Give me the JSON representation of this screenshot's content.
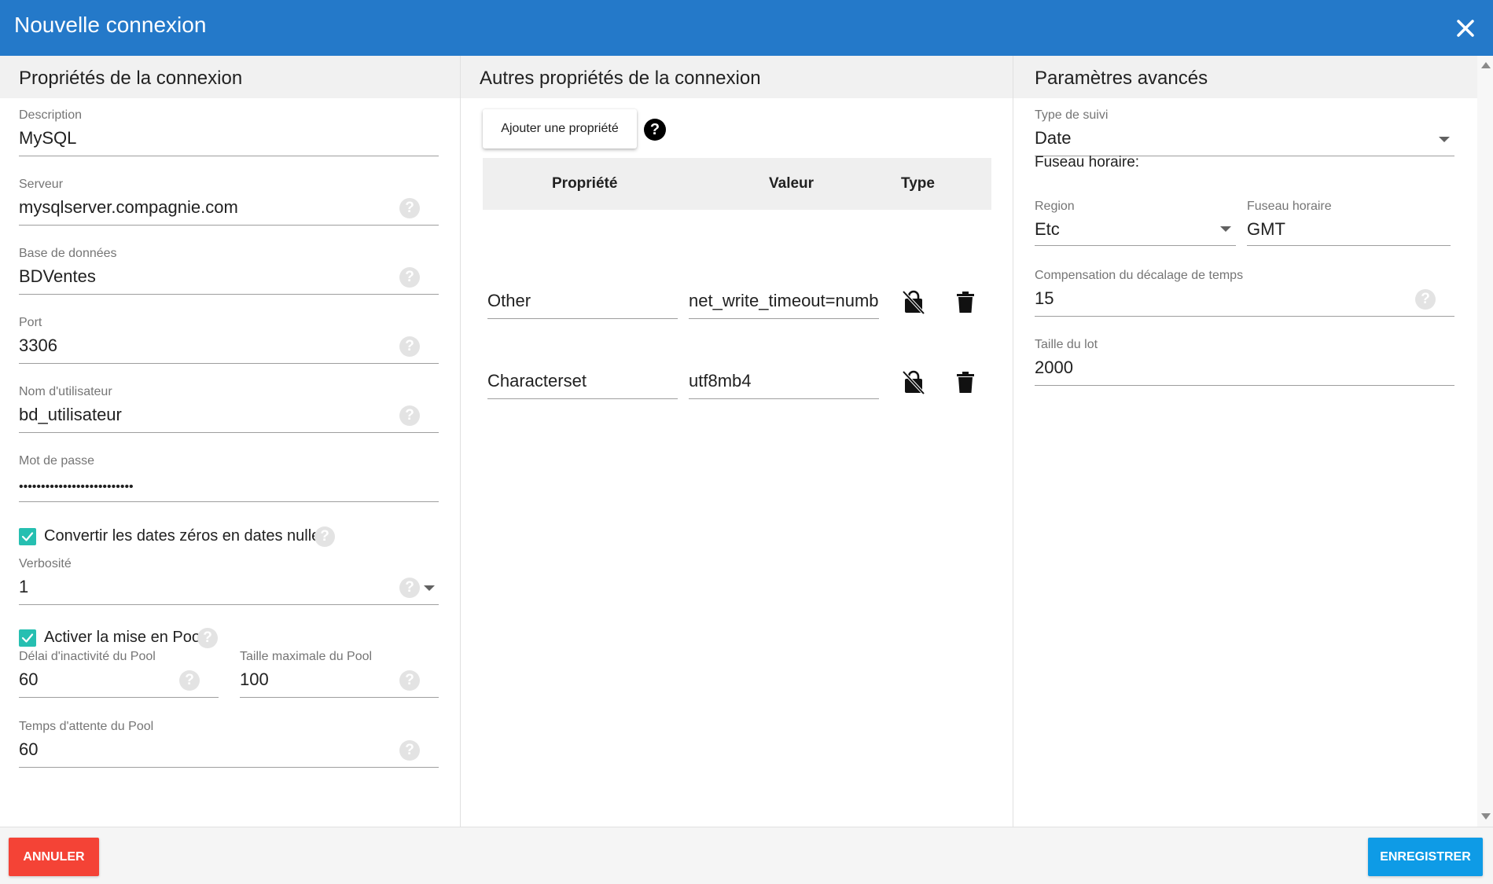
{
  "dialog": {
    "title": "Nouvelle connexion",
    "close_icon": "close-icon"
  },
  "left": {
    "header": "Propriétés de la connexion",
    "description": {
      "label": "Description",
      "value": "MySQL"
    },
    "server": {
      "label": "Serveur",
      "value": "mysqlserver.compagnie.com"
    },
    "database": {
      "label": "Base de données",
      "value": "BDVentes"
    },
    "port": {
      "label": "Port",
      "value": "3306"
    },
    "username": {
      "label": "Nom d'utilisateur",
      "value": "bd_utilisateur"
    },
    "password": {
      "label": "Mot de passe",
      "value": "••••••••••••••••••••••••••"
    },
    "zero_dates": {
      "label": "Convertir les dates zéros en dates nulles",
      "checked": true
    },
    "verbosity": {
      "label": "Verbosité",
      "value": "1"
    },
    "pooling": {
      "label": "Activer la mise en Pool",
      "checked": true
    },
    "pool_idle": {
      "label": "Délai d'inactivité du Pool",
      "value": "60"
    },
    "pool_max": {
      "label": "Taille maximale du Pool",
      "value": "100"
    },
    "pool_wait": {
      "label": "Temps d'attente du Pool",
      "value": "60"
    }
  },
  "middle": {
    "header": "Autres propriétés de la connexion",
    "add_button": "Ajouter une propriété",
    "help_glyph": "?",
    "columns": [
      "Propriété",
      "Valeur",
      "Type"
    ],
    "rows": [
      {
        "property": "Other",
        "value": "net_write_timeout=number",
        "type_icon": "lock-off-icon",
        "delete_icon": "trash-icon"
      },
      {
        "property": "Characterset",
        "value": "utf8mb4",
        "type_icon": "lock-off-icon",
        "delete_icon": "trash-icon"
      }
    ]
  },
  "right": {
    "header": "Paramètres avancés",
    "tracking_type": {
      "label": "Type de suivi",
      "value": "Date"
    },
    "timezone_title": "Fuseau horaire:",
    "region": {
      "label": "Region",
      "value": "Etc"
    },
    "timezone": {
      "label": "Fuseau horaire",
      "value": "GMT"
    },
    "time_offset": {
      "label": "Compensation du décalage de temps",
      "value": "15"
    },
    "batch_size": {
      "label": "Taille du lot",
      "value": "2000"
    }
  },
  "help_glyph": "?",
  "footer": {
    "cancel": "ANNULER",
    "save": "ENREGISTRER"
  },
  "colors": {
    "titlebar": "#2479c9",
    "checkbox": "#26bfb1",
    "cancel": "#f44336",
    "save": "#0e9be6"
  }
}
